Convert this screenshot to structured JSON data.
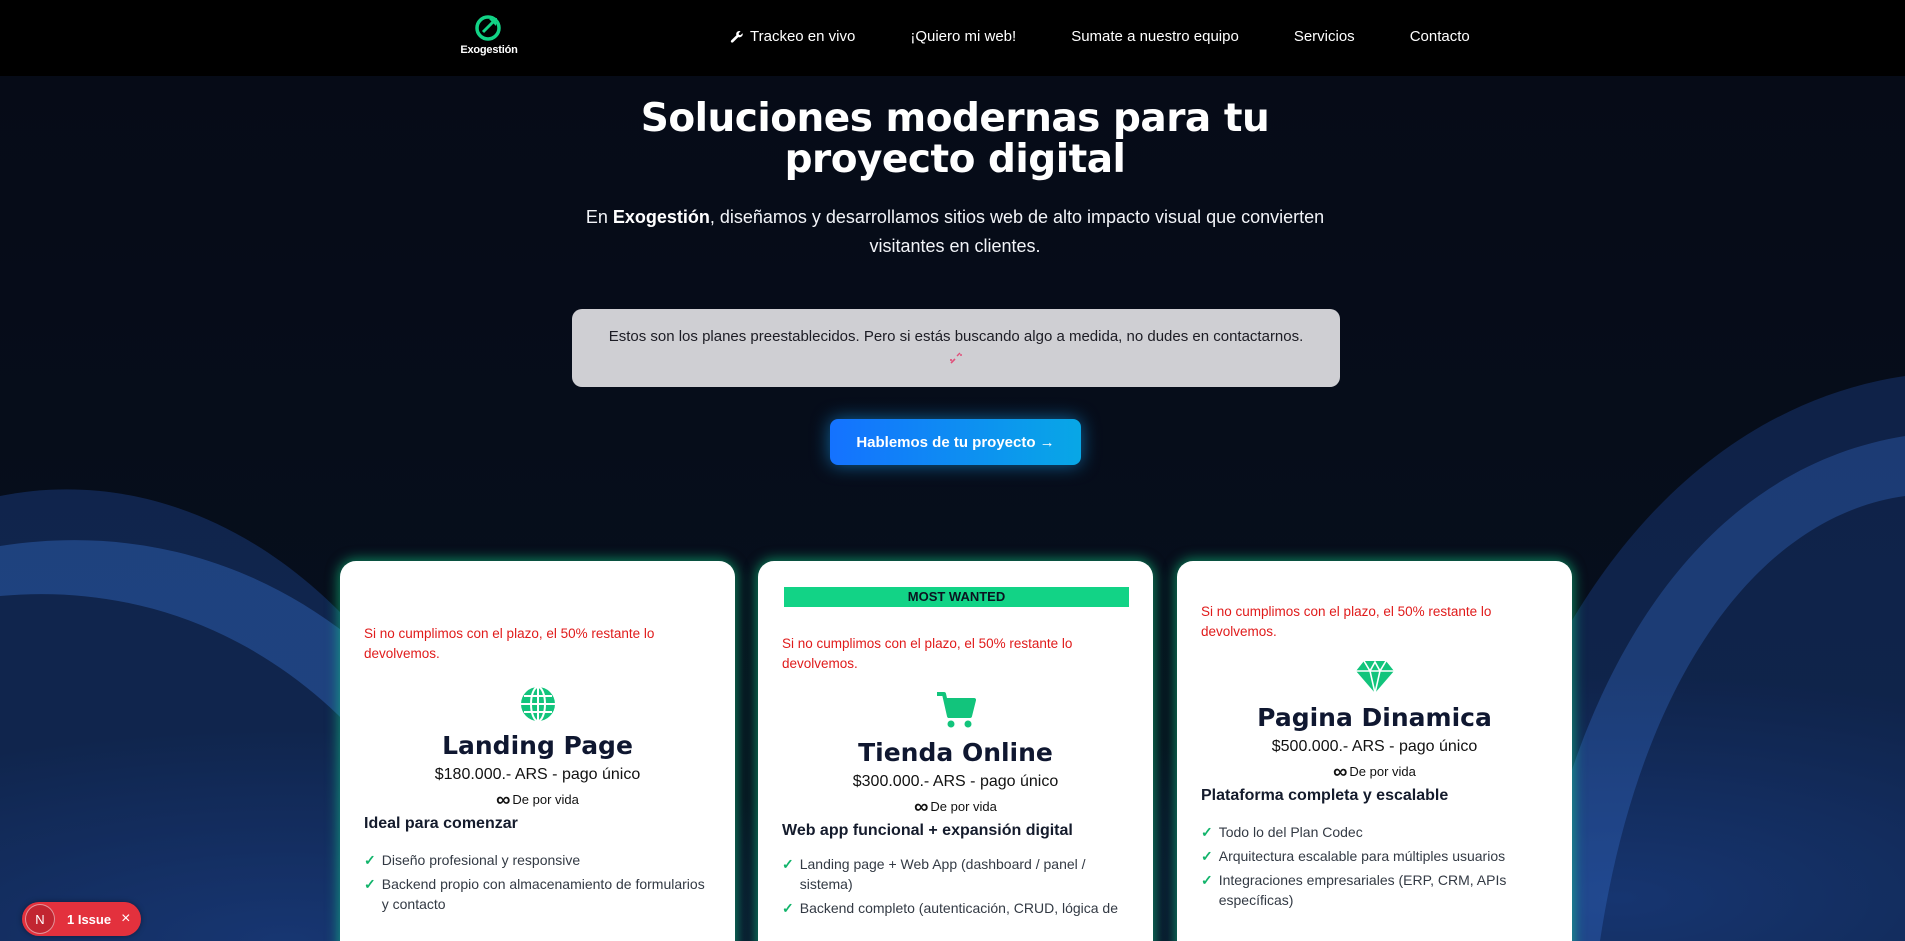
{
  "brand": {
    "name": "Exogestión",
    "accent": "#12d386"
  },
  "nav": {
    "items": [
      {
        "label": "Trackeo en vivo",
        "icon": "wrench-icon"
      },
      {
        "label": "¡Quiero mi web!"
      },
      {
        "label": "Sumate a nuestro equipo"
      },
      {
        "label": "Servicios"
      },
      {
        "label": "Contacto"
      }
    ]
  },
  "hero": {
    "title": "Soluciones modernas para tu proyecto digital",
    "subtitle_pre": "En ",
    "subtitle_brand": "Exogestión",
    "subtitle_post": ", diseñamos y desarrollamos sitios web de alto impacto visual que convierten visitantes en clientes."
  },
  "notice": {
    "text": "Estos son los planes preestablecidos. Pero si estás buscando algo a medida, no dudes en contactarnos."
  },
  "cta": {
    "label": "Hablemos de tu proyecto →"
  },
  "plans": [
    {
      "guarantee": "Si no cumplimos con el plazo, el 50% restante lo devolvemos.",
      "icon": "globe-icon",
      "title": "Landing Page",
      "price": "$180.000.- ARS - pago único",
      "lifetime": "De por vida",
      "subtitle": "Ideal para comenzar",
      "features": [
        "Diseño profesional y responsive",
        "Backend propio con almacenamiento de formularios y contacto"
      ]
    },
    {
      "badge": "MOST WANTED",
      "guarantee": "Si no cumplimos con el plazo, el 50% restante lo devolvemos.",
      "icon": "shopping-cart-icon",
      "title": "Tienda Online",
      "price": "$300.000.- ARS - pago único",
      "lifetime": "De por vida",
      "subtitle": "Web app funcional + expansión digital",
      "features": [
        "Landing page + Web App (dashboard / panel / sistema)",
        "Backend completo (autenticación, CRUD, lógica de"
      ]
    },
    {
      "guarantee": "Si no cumplimos con el plazo, el 50% restante lo devolvemos.",
      "icon": "diamond-icon",
      "title": "Pagina Dinamica",
      "price": "$500.000.- ARS - pago único",
      "lifetime": "De por vida",
      "subtitle": "Plataforma completa y escalable",
      "features": [
        "Todo lo del Plan Codec",
        "Arquitectura escalable para múltiples usuarios",
        "Integraciones empresariales (ERP, CRM, APIs específicas)"
      ]
    }
  ],
  "dev_indicator": {
    "logo": "N",
    "label": "1 Issue",
    "close": "×"
  }
}
